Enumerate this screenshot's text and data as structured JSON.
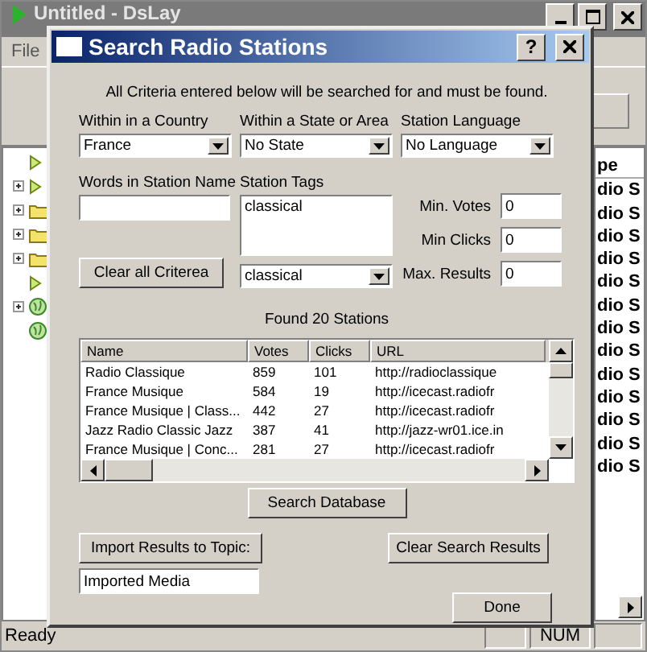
{
  "app": {
    "title": "Untitled - DsLay",
    "menu": [
      "File"
    ],
    "tree": [
      {
        "kind": "play",
        "expandable": false
      },
      {
        "kind": "play",
        "expandable": true
      },
      {
        "kind": "folder",
        "expandable": true
      },
      {
        "kind": "folder",
        "expandable": true
      },
      {
        "kind": "folder",
        "expandable": true
      },
      {
        "kind": "play",
        "expandable": false
      },
      {
        "kind": "globe",
        "expandable": true
      },
      {
        "kind": "globe",
        "expandable": false
      }
    ],
    "list": {
      "header": "pe",
      "rows": [
        "dio S",
        "dio S",
        "dio S",
        "dio S",
        "dio S",
        "dio S",
        "dio S",
        "dio S",
        "dio S",
        "dio S",
        "dio S",
        "dio S",
        "dio S"
      ]
    },
    "status": {
      "text": "Ready",
      "panels": [
        "NUM"
      ]
    }
  },
  "dialog": {
    "title": "Search Radio Stations",
    "help": "?",
    "instructions": "All Criteria entered below will be searched for and must be found.",
    "selects": [
      {
        "label": "Within in a Country",
        "value": "France"
      },
      {
        "label": "Within a State or Area",
        "value": "No State"
      },
      {
        "label": "Station Language",
        "value": "No Language"
      }
    ],
    "station_name": {
      "label": "Words in Station Name"
    },
    "tags": {
      "label": "Station Tags",
      "value": "classical",
      "select_value": "classical"
    },
    "numbers": [
      {
        "label": "Min. Votes",
        "value": "0"
      },
      {
        "label": "Min Clicks",
        "value": "0"
      },
      {
        "label": "Max. Results",
        "value": "0"
      }
    ],
    "clear_criteria": "Clear all Criterea",
    "found": "Found 20 Stations",
    "table": {
      "columns": [
        "Name",
        "Votes",
        "Clicks",
        "URL"
      ],
      "rows": [
        [
          "Radio Classique",
          "859",
          "101",
          "http://radioclassique"
        ],
        [
          "France Musique",
          "584",
          "19",
          "http://icecast.radiofr"
        ],
        [
          "France Musique | Class...",
          "442",
          "27",
          "http://icecast.radiofr"
        ],
        [
          "Jazz Radio Classic Jazz",
          "387",
          "41",
          "http://jazz-wr01.ice.in"
        ],
        [
          "France Musique | Conc...",
          "281",
          "27",
          "http://icecast.radiofr"
        ]
      ]
    },
    "search_button": "Search Database",
    "import_button": "Import Results to Topic:",
    "clear_results": "Clear Search Results",
    "topic": {
      "value": "Imported Media"
    },
    "done": "Done"
  }
}
